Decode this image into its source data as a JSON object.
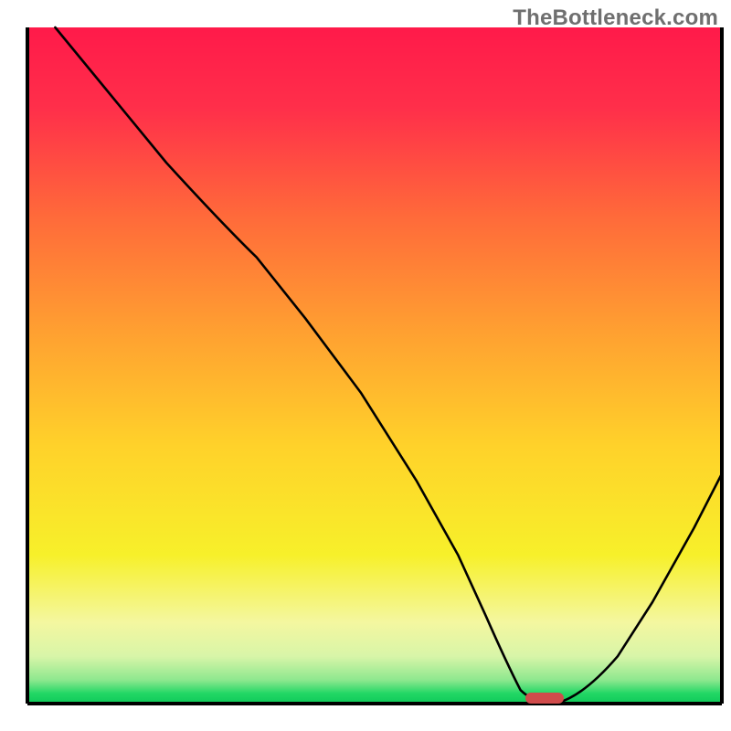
{
  "watermark": "TheBottleneck.com",
  "chart_data": {
    "type": "line",
    "title": "",
    "xlabel": "",
    "ylabel": "",
    "xlim": [
      0,
      100
    ],
    "ylim": [
      0,
      100
    ],
    "grid": false,
    "legend": false,
    "annotations": [],
    "background_gradient": {
      "description": "vertical gradient red→orange→yellow→pale-yellow→green, with a thin bright-green baseline band",
      "stops": [
        {
          "pos": 0.0,
          "color": "#ff1a4a"
        },
        {
          "pos": 0.12,
          "color": "#ff2f4a"
        },
        {
          "pos": 0.28,
          "color": "#ff6a3a"
        },
        {
          "pos": 0.45,
          "color": "#ffa031"
        },
        {
          "pos": 0.62,
          "color": "#ffd22a"
        },
        {
          "pos": 0.78,
          "color": "#f7f02a"
        },
        {
          "pos": 0.88,
          "color": "#f4f7a0"
        },
        {
          "pos": 0.93,
          "color": "#d8f5a8"
        },
        {
          "pos": 0.965,
          "color": "#8ee88f"
        },
        {
          "pos": 0.985,
          "color": "#22d765"
        },
        {
          "pos": 1.0,
          "color": "#0fc95a"
        }
      ]
    },
    "series": [
      {
        "name": "bottleneck-curve",
        "color": "#000000",
        "stroke_width": 2,
        "x": [
          4,
          12,
          20,
          28,
          33,
          40,
          48,
          56,
          62,
          66,
          69,
          71,
          73,
          76,
          80,
          85,
          90,
          96,
          100
        ],
        "y": [
          100,
          90,
          80,
          71,
          66,
          57,
          46,
          33,
          22,
          13,
          6,
          2,
          0,
          0,
          1,
          7,
          15,
          26,
          34
        ]
      }
    ],
    "marker": {
      "name": "optimal-point",
      "shape": "rounded-rect",
      "color": "#d04b4b",
      "x": 74.5,
      "y": 0,
      "width_pct": 5.5,
      "height_pct": 1.6
    },
    "frame": {
      "color": "#000000",
      "left": true,
      "right": true,
      "bottom": true,
      "top": false
    }
  }
}
